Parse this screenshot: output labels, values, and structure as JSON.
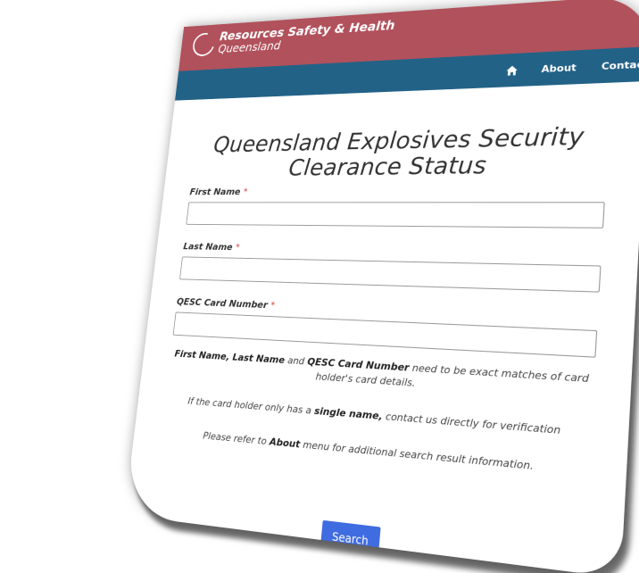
{
  "brand": {
    "line1": "Resources Safety & Health",
    "line2": "Queensland"
  },
  "nav": {
    "home_icon": "home-icon",
    "about": "About",
    "contact": "Contact"
  },
  "page": {
    "title": "Queensland Explosives Security Clearance Status"
  },
  "form": {
    "first_name_label": "First Name",
    "last_name_label": "Last Name",
    "card_number_label": "QESC Card Number",
    "required_mark": "*",
    "first_name_value": "",
    "last_name_value": "",
    "card_number_value": ""
  },
  "notes": {
    "match_b1": "First Name, Last Name",
    "match_t1": "and",
    "match_b2": "QESC Card Number",
    "match_t2": "need to be exact matches of card holder's card details.",
    "single_t1": "If the card holder only has a",
    "single_b": "single name,",
    "single_t2": "contact us directly for verification",
    "about_t1": "Please refer to",
    "about_b": "About",
    "about_t2": "menu for additional search result information."
  },
  "actions": {
    "search_label": "Search"
  },
  "colors": {
    "brand_bar": "#b1515c",
    "nav_bar": "#236287",
    "button": "#3f6ce0"
  }
}
